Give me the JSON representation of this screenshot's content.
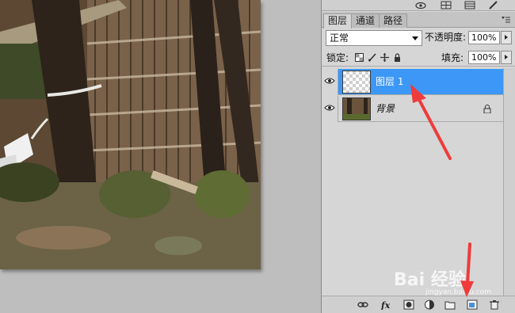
{
  "layers_panel": {
    "tabs": [
      {
        "label": "图层",
        "active": true
      },
      {
        "label": "通道",
        "active": false
      },
      {
        "label": "路径",
        "active": false
      }
    ],
    "blend_mode": "正常",
    "opacity_label": "不透明度:",
    "opacity_value": "100%",
    "lock_label": "锁定:",
    "fill_label": "填充:",
    "fill_value": "100%",
    "layers": [
      {
        "name": "图层 1",
        "selected": true,
        "visible": true,
        "thumbnail": "transparent"
      },
      {
        "name": "背景",
        "selected": false,
        "visible": true,
        "locked": true,
        "thumbnail": "photo"
      }
    ],
    "bottom_icons": [
      "link-icon",
      "fx-icon",
      "mask-icon",
      "adjustment-icon",
      "folder-icon",
      "new-layer-icon",
      "trash-icon"
    ]
  },
  "canvas": {
    "description_colors": {
      "selected_layer": "#3c97f7"
    }
  },
  "watermark": {
    "text": "Bai 经验",
    "sub": "jingyan.baidu.com"
  },
  "colors": {
    "accent": "#3c97f7",
    "annotation_arrow": "#ef3b3b",
    "panel_bg": "#d6d6d6"
  }
}
